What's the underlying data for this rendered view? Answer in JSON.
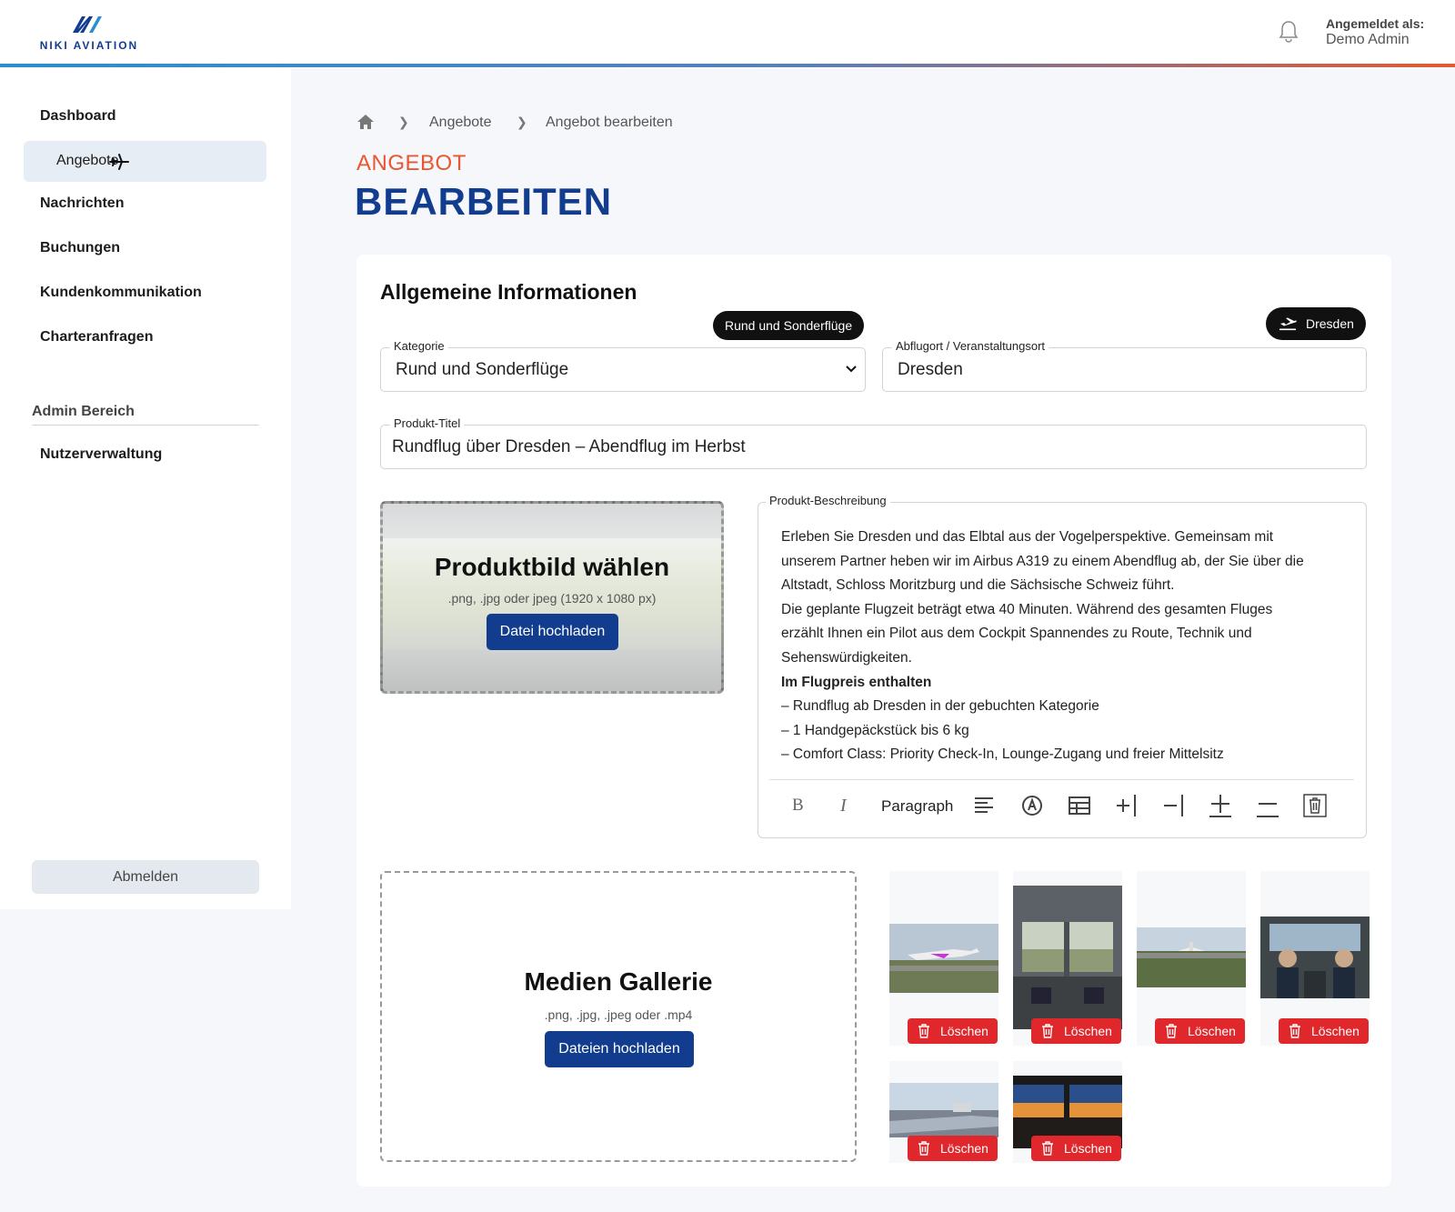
{
  "header": {
    "brand": "NIKI AVIATION",
    "user_label": "Angemeldet als:",
    "user_name": "Demo Admin"
  },
  "sidebar": {
    "items": [
      {
        "label": "Dashboard"
      },
      {
        "label": "Angebote"
      },
      {
        "label": "Nachrichten"
      },
      {
        "label": "Buchungen"
      },
      {
        "label": "Kundenkommunikation"
      },
      {
        "label": "Charteranfragen"
      }
    ],
    "active_index": 1,
    "admin_section": "Admin Bereich",
    "admin_items": [
      {
        "label": "Nutzerverwaltung"
      }
    ],
    "logout": "Abmelden"
  },
  "breadcrumb": {
    "items": [
      "Angebote",
      "Angebot bearbeiten"
    ]
  },
  "page": {
    "title_small": "ANGEBOT",
    "title_big": "BEARBEITEN"
  },
  "section": {
    "title": "Allgemeine Informationen"
  },
  "chips": {
    "category": "Rund und Sonderflüge",
    "location": "Dresden"
  },
  "fields": {
    "kategorie": {
      "label": "Kategorie",
      "value": "Rund und Sonderflüge"
    },
    "abflugort": {
      "label": "Abflugort / Veranstaltungsort",
      "value": "Dresden"
    },
    "titel": {
      "label": "Produkt-Titel",
      "value": "Rundflug über Dresden – Abendflug im Herbst"
    }
  },
  "product_image": {
    "title": "Produktbild wählen",
    "hint": ".png, .jpg oder jpeg (1920 x 1080 px)",
    "button": "Datei hochladen"
  },
  "description": {
    "label": "Produkt-Beschreibung",
    "lines": [
      "Erleben Sie Dresden und das Elbtal aus der Vogelperspektive. Gemeinsam mit",
      "unserem Partner heben wir im Airbus A319 zu einem Abendflug ab, der Sie über die",
      "Altstadt, Schloss Moritzburg und die Sächsische Schweiz führt.",
      "Die geplante Flugzeit beträgt etwa 40 Minuten. Während des gesamten Fluges",
      "erzählt Ihnen ein Pilot aus dem Cockpit Spannendes zu Route, Technik und",
      "Sehenswürdigkeiten.",
      "Im Flugpreis enthalten",
      "– Rundflug ab Dresden in der gebuchten Kategorie",
      "– 1 Handgepäckstück bis 6 kg",
      "– Comfort Class: Priority Check-In, Lounge-Zugang und freier Mittelsitz"
    ],
    "toolbar": {
      "bold": "B",
      "italic": "I",
      "paragraph": "Paragraph"
    }
  },
  "gallery": {
    "title": "Medien Gallerie",
    "hint": ".png, .jpg, .jpeg oder .mp4",
    "button": "Dateien hochladen",
    "delete_label": "Löschen",
    "thumbnails": [
      {
        "name": "thumb-airplane-takeoff",
        "icon": "airplane-image"
      },
      {
        "name": "thumb-cockpit-view",
        "icon": "cockpit-image"
      },
      {
        "name": "thumb-airport-runway",
        "icon": "airport-image"
      },
      {
        "name": "thumb-pilots-cockpit",
        "icon": "pilots-image"
      },
      {
        "name": "thumb-wing-view",
        "icon": "wing-image"
      },
      {
        "name": "thumb-cockpit-sunset",
        "icon": "sunset-image"
      }
    ]
  },
  "colors": {
    "brand_blue": "#123d8e",
    "accent_orange": "#e8572f",
    "delete_red": "#e0272b"
  }
}
